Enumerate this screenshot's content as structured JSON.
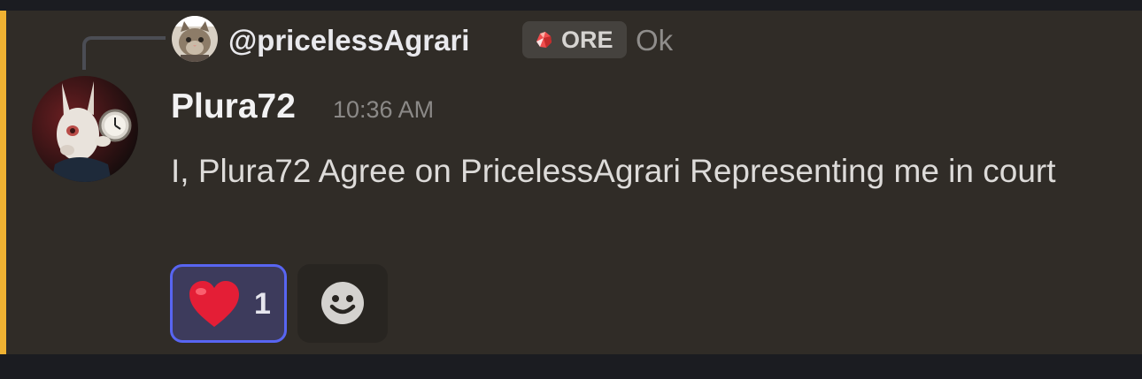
{
  "reply": {
    "author": "@pricelessAgrari",
    "badge_tag": "ORE",
    "badge_icon": "ore-crystal-icon",
    "content": "Ok"
  },
  "message": {
    "author": "Plura72",
    "timestamp": "10:36 AM",
    "content": "I, Plura72 Agree on PricelessAgrari Representing me in court"
  },
  "reactions": [
    {
      "emoji": "heart-icon",
      "count": "1",
      "active": true
    }
  ],
  "add_reaction": {
    "icon": "smile-icon"
  },
  "colors": {
    "background": "#1b1c21",
    "message_highlight": "#302c27",
    "mention_bar": "#f0b232",
    "reaction_active_border": "#5865f2",
    "reaction_active_bg": "#3d3b5c"
  }
}
